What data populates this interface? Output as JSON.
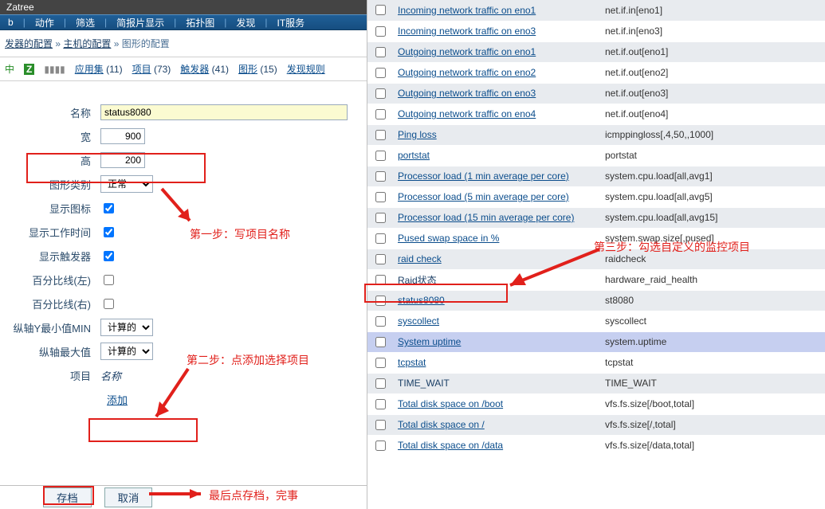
{
  "brand": "Zatree",
  "menu": {
    "items": [
      "b",
      "动作",
      "筛选",
      "简报片显示",
      "拓扑图",
      "发现",
      "IT服务"
    ]
  },
  "crumb": {
    "a": "发器的配置",
    "b": "主机的配置",
    "c": "图形的配置"
  },
  "toolbar": {
    "status": "中",
    "z": "Z",
    "apps_lbl": "应用集",
    "apps_cnt": "(11)",
    "items_lbl": "项目",
    "items_cnt": "(73)",
    "trig_lbl": "触发器",
    "trig_cnt": "(41)",
    "graph_lbl": "图形",
    "graph_cnt": "(15)",
    "disc_lbl": "发现规则"
  },
  "form": {
    "name_lbl": "名称",
    "name_val": "status8080",
    "width_lbl": "宽",
    "width_val": "900",
    "height_lbl": "高",
    "height_val": "200",
    "type_lbl": "图形类别",
    "type_val": "正常",
    "legend_lbl": "显示图标",
    "worktime_lbl": "显示工作时间",
    "trig_lbl": "显示触发器",
    "pctl_lbl": "百分比线(左)",
    "pctr_lbl": "百分比线(右)",
    "ymin_lbl": "纵轴Y最小值MIN",
    "ymin_val": "计算的",
    "ymax_lbl": "纵轴最大值",
    "ymax_val": "计算的",
    "items_lbl": "项目",
    "items_colhdr": "名称",
    "add_lbl": "添加",
    "save": "存档",
    "cancel": "取消"
  },
  "ann": {
    "step1": "第一步：写项目名称",
    "step2": "第二步：点添加选择项目",
    "step3": "第三步：勾选自定义的监控项目",
    "final": "最后点存档，完事"
  },
  "items": [
    {
      "name": "Incoming network traffic on eno1",
      "key": "net.if.in[eno1]"
    },
    {
      "name": "Incoming network traffic on eno3",
      "key": "net.if.in[eno3]"
    },
    {
      "name": "Outgoing network traffic on eno1",
      "key": "net.if.out[eno1]"
    },
    {
      "name": "Outgoing network traffic on eno2",
      "key": "net.if.out[eno2]"
    },
    {
      "name": "Outgoing network traffic on eno3",
      "key": "net.if.out[eno3]"
    },
    {
      "name": "Outgoing network traffic on eno4",
      "key": "net.if.out[eno4]"
    },
    {
      "name": "Ping loss",
      "key": "icmppingloss[,4,50,,1000]"
    },
    {
      "name": "portstat",
      "key": "portstat"
    },
    {
      "name": "Processor load (1 min average per core)",
      "key": "system.cpu.load[all,avg1]"
    },
    {
      "name": "Processor load (5 min average per core)",
      "key": "system.cpu.load[all,avg5]"
    },
    {
      "name": "Processor load (15 min average per core)",
      "key": "system.cpu.load[all,avg15]"
    },
    {
      "name": "Pused swap space in %",
      "key": "system.swap.size[,pused]"
    },
    {
      "name": "raid check",
      "key": "raidcheck"
    },
    {
      "name": "Raid状态",
      "key": "hardware_raid_health",
      "plain": true
    },
    {
      "name": "status8080",
      "key": "st8080"
    },
    {
      "name": "syscollect",
      "key": "syscollect"
    },
    {
      "name": "System uptime",
      "key": "system.uptime",
      "sel": true
    },
    {
      "name": "tcpstat",
      "key": "tcpstat"
    },
    {
      "name": "TIME_WAIT",
      "key": "TIME_WAIT",
      "plain": true
    },
    {
      "name": "Total disk space on /boot",
      "key": "vfs.fs.size[/boot,total]"
    },
    {
      "name": "Total disk space on /",
      "key": "vfs.fs.size[/,total]"
    },
    {
      "name": "Total disk space on /data",
      "key": "vfs.fs.size[/data,total]"
    }
  ]
}
